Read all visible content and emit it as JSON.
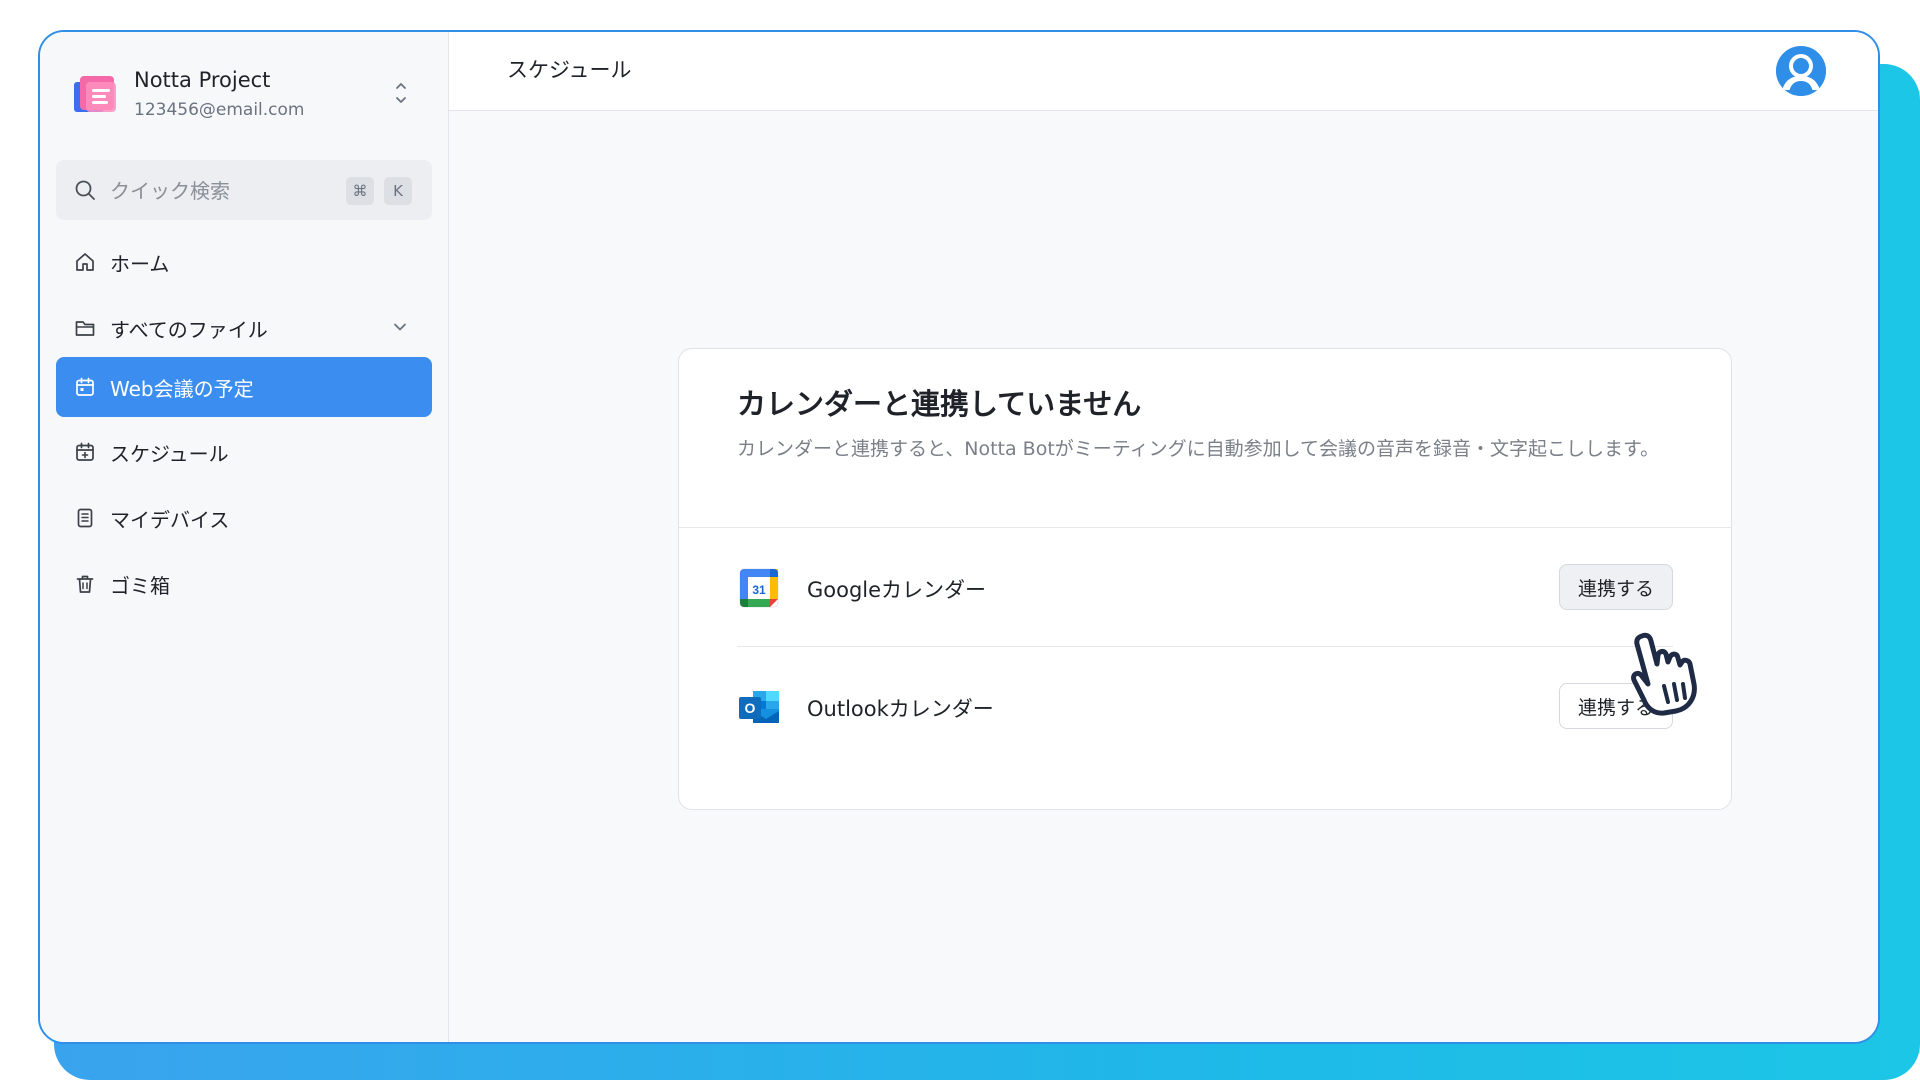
{
  "colors": {
    "accent": "#3b8ef0",
    "window_border": "#2f8fe8",
    "backdrop": "#1fb8e8"
  },
  "sidebar": {
    "project": {
      "name": "Notta Project",
      "email": "123456@email.com"
    },
    "search": {
      "placeholder": "クイック検索",
      "shortcut_cmd": "⌘",
      "shortcut_key": "K"
    },
    "items": [
      {
        "label": "ホーム",
        "icon": "home-icon"
      },
      {
        "label": "すべてのファイル",
        "icon": "folder-icon",
        "expandable": true
      },
      {
        "label": "Web会議の予定",
        "icon": "calendar-icon",
        "active": true
      },
      {
        "label": "スケジュール",
        "icon": "calendar-plus-icon"
      },
      {
        "label": "マイデバイス",
        "icon": "device-icon"
      },
      {
        "label": "ゴミ箱",
        "icon": "trash-icon"
      }
    ]
  },
  "header": {
    "title": "スケジュール"
  },
  "card": {
    "title": "カレンダーと連携していません",
    "description": "カレンダーと連携すると、Notta Botがミーティングに自動参加して会議の音声を録音・文字起こしします。",
    "integrations": [
      {
        "name": "Googleカレンダー",
        "icon": "google-calendar-icon",
        "button": "連携する"
      },
      {
        "name": "Outlookカレンダー",
        "icon": "outlook-icon",
        "button": "連携する"
      }
    ]
  }
}
